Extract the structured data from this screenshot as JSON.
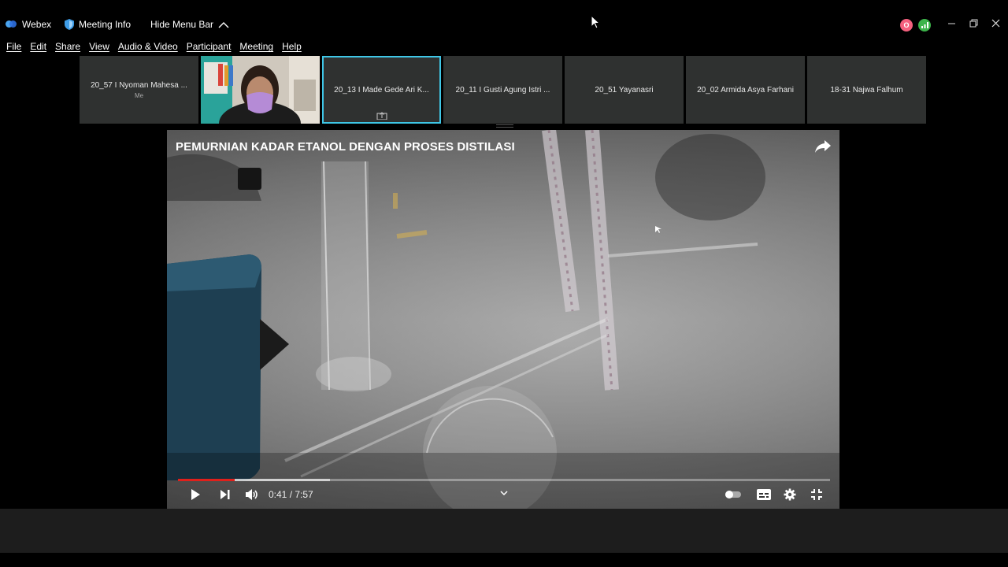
{
  "titlebar": {
    "app_name": "Webex",
    "meeting_info": "Meeting Info",
    "hide_menu_bar": "Hide Menu Bar",
    "status_badge_1": "O"
  },
  "menu": [
    {
      "label": "File"
    },
    {
      "label": "Edit"
    },
    {
      "label": "Share"
    },
    {
      "label": "View"
    },
    {
      "label": "Audio & Video"
    },
    {
      "label": "Participant"
    },
    {
      "label": "Meeting"
    },
    {
      "label": "Help"
    }
  ],
  "participants": {
    "p1": {
      "name": "20_57 I Nyoman Mahesa ...",
      "sub": "Me"
    },
    "p3": {
      "name": "20_13 I Made Gede Ari K..."
    },
    "p4": {
      "name": "20_11 I Gusti Agung Istri ..."
    },
    "p5": {
      "name": "20_51 Yayanasri"
    },
    "p6": {
      "name": "20_02 Armida Asya Farhani"
    },
    "p7": {
      "name": "18-31 Najwa Falhum"
    }
  },
  "video": {
    "title": "PEMURNIAN KADAR ETANOL DENGAN PROSES DISTILASI",
    "time": "0:41 / 7:57",
    "progress_played": 0.087,
    "progress_buffered": 0.233
  },
  "colors": {
    "accent": "#3fc6e6",
    "progress": "#e0201b",
    "status_pink": "#f4607e",
    "status_green": "#3cb44a"
  }
}
